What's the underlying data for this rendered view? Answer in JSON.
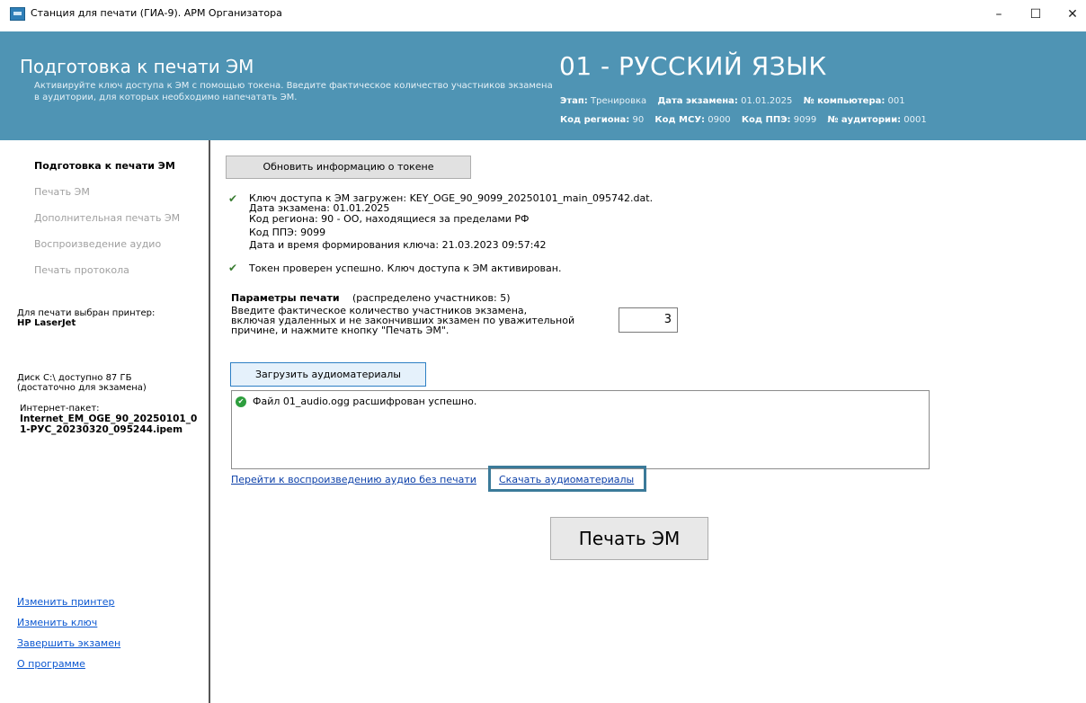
{
  "window": {
    "title": "Станция для печати (ГИА-9). АРМ Организатора",
    "minimize_glyph": "–",
    "maximize_glyph": "☐",
    "close_glyph": "✕"
  },
  "header": {
    "title": "Подготовка к печати ЭМ",
    "subtitle": "Активируйте ключ доступа к ЭМ с помощью токена. Введите фактическое количество участников экзамена в аудитории, для которых необходимо напечатать ЭМ.",
    "subject": "01 - РУССКИЙ ЯЗЫК",
    "stage_label": "Этап:",
    "stage_value": "Тренировка",
    "exam_date_label": "Дата экзамена:",
    "exam_date_value": "01.01.2025",
    "computer_label": "№ компьютера:",
    "computer_value": "001",
    "region_label": "Код региона:",
    "region_value": "90",
    "msu_label": "Код МСУ:",
    "msu_value": "0900",
    "ppe_label": "Код ППЭ:",
    "ppe_value": "9099",
    "room_label": "№ аудитории:",
    "room_value": "0001"
  },
  "sidebar": {
    "items": [
      {
        "label": "Подготовка к печати ЭМ"
      },
      {
        "label": "Печать ЭМ"
      },
      {
        "label": "Дополнительная печать ЭМ"
      },
      {
        "label": "Воспроизведение аудио"
      },
      {
        "label": "Печать протокола"
      }
    ],
    "printer_label": "Для печати выбран принтер:",
    "printer_value": "HP LaserJet",
    "disk_line1": "Диск C:\\ доступно 87 ГБ",
    "disk_line2": "(достаточно для экзамена)",
    "package_label": "Интернет-пакет:",
    "package_line1": "Internet_EM_OGE_90_20250101_0",
    "package_line2": "1-РУС_20230320_095244.ipem",
    "links": {
      "change_printer": "Изменить принтер",
      "change_key": "Изменить ключ",
      "finish_exam": "Завершить экзамен",
      "about": "О программе"
    }
  },
  "main": {
    "refresh_button": "Обновить информацию о токене",
    "key_loaded": "Ключ доступа к ЭМ загружен: KEY_OGE_90_9099_20250101_main_095742.dat.",
    "key_date": "Дата экзамена: 01.01.2025",
    "key_region": "Код региона: 90 - ОО, находящиеся за пределами РФ",
    "key_ppe": "Код ППЭ: 9099",
    "key_created": "Дата и время формирования ключа: 21.03.2023 09:57:42",
    "token_ok": "Токен проверен успешно. Ключ доступа к ЭМ активирован.",
    "params_title": "Параметры печати",
    "params_distributed": "(распределено участников: 5)",
    "params_line1": "Введите фактическое количество участников экзамена,",
    "params_line2": "включая удаленных и не закончивших экзамен по уважительной",
    "params_line3": "причине, и нажмите кнопку \"Печать ЭМ\".",
    "participants_value": "3",
    "load_audio_button": "Загрузить аудиоматериалы",
    "log_message": "Файл 01_audio.ogg расшифрован успешно.",
    "link_audio_no_print": "Перейти к воспроизведению аудио без печати",
    "link_download_audio": "Скачать аудиоматериалы",
    "print_button": "Печать ЭМ",
    "check_glyph": "✔",
    "ok_glyph": "✔"
  },
  "colors": {
    "header_bg": "#4f94b4",
    "link": "#0b57d0",
    "check": "#3a7d32",
    "highlight_frame": "#3b7a99"
  }
}
